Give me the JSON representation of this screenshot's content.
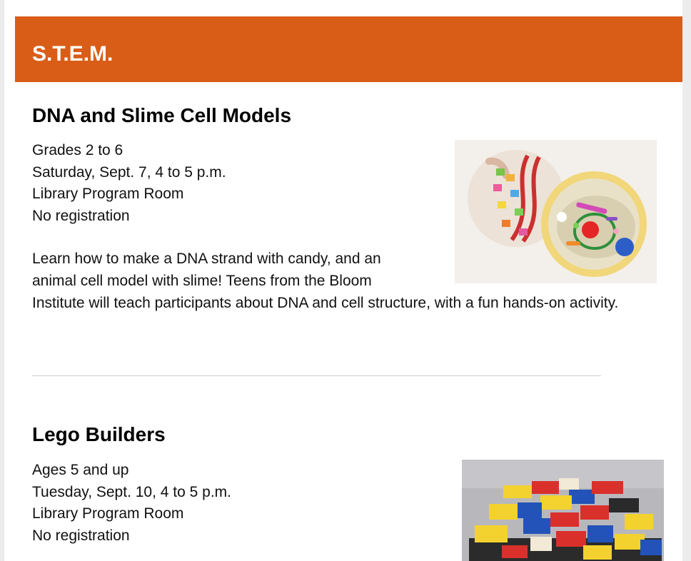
{
  "section": {
    "title": "S.T.E.M.",
    "header_color": "#d95d17"
  },
  "events": [
    {
      "title": "DNA and Slime Cell Models",
      "audience": "Grades 2 to 6",
      "datetime": "Saturday, Sept. 7, 4 to 5 p.m.",
      "location": "Library Program Room",
      "registration": "No registration",
      "description": "Learn how to make a DNA strand with candy, and an animal cell model with slime! Teens from the Bloom Institute will teach participants about DNA and cell structure, with a fun hands-on activity.",
      "image_icon": "dna-and-slime-cell-photo"
    },
    {
      "title": "Lego Builders",
      "audience": "Ages 5 and up",
      "datetime": "Tuesday, Sept. 10, 4 to 5 p.m.",
      "location": "Library Program Room",
      "registration": "No registration",
      "image_icon": "lego-bricks-photo"
    }
  ]
}
